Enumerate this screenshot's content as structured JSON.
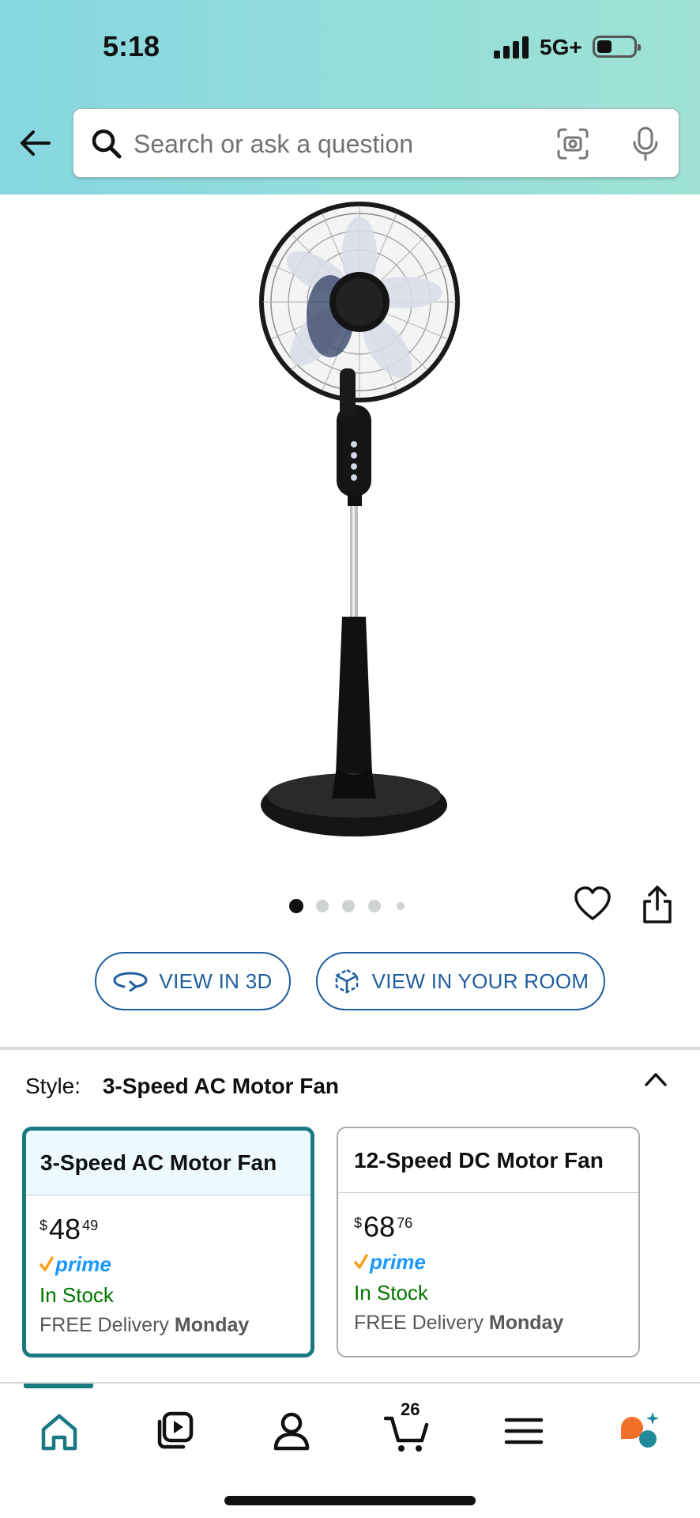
{
  "status_bar": {
    "time": "5:18",
    "network": "5G+"
  },
  "search": {
    "placeholder": "Search or ask a question"
  },
  "gallery": {
    "image_count": 5,
    "active_index": 0
  },
  "buttons": {
    "view_3d": "VIEW IN 3D",
    "view_room": "VIEW IN YOUR ROOM"
  },
  "style_selector": {
    "label": "Style:",
    "selected": "3-Speed AC Motor Fan",
    "options": [
      {
        "name": "3-Speed AC Motor Fan",
        "currency": "$",
        "price_whole": "48",
        "price_fraction": "49",
        "prime": "prime",
        "stock": "In Stock",
        "delivery_prefix": "FREE Delivery",
        "delivery_day": "Monday"
      },
      {
        "name": "12-Speed DC Motor Fan",
        "currency": "$",
        "price_whole": "68",
        "price_fraction": "76",
        "prime": "prime",
        "stock": "In Stock",
        "delivery_prefix": "FREE Delivery",
        "delivery_day": "Monday"
      }
    ]
  },
  "bottom_nav": {
    "cart_count": "26"
  },
  "colors": {
    "accent": "#1a7883",
    "link_blue": "#1f5e9e",
    "prime_blue": "#1a98ff",
    "in_stock_green": "#007600"
  }
}
